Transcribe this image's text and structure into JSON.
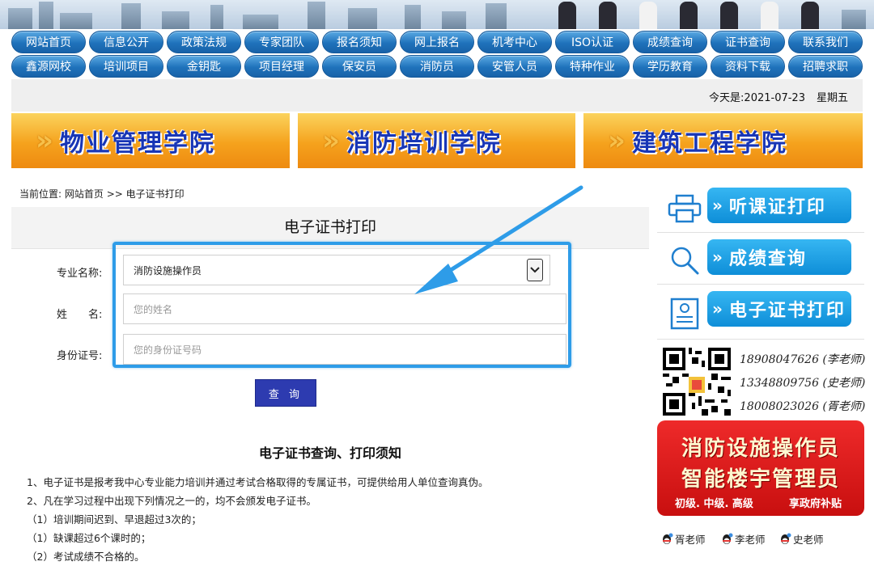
{
  "nav": {
    "row1": [
      "网站首页",
      "信息公开",
      "政策法规",
      "专家团队",
      "报名须知",
      "网上报名",
      "机考中心",
      "ISO认证",
      "成绩查询",
      "证书查询",
      "联系我们"
    ],
    "row2": [
      "鑫源网校",
      "培训项目",
      "金钥匙",
      "项目经理",
      "保安员",
      "消防员",
      "安管人员",
      "特种作业",
      "学历教育",
      "资料下载",
      "招聘求职"
    ]
  },
  "datebar": {
    "date": "今天是:2021-07-23",
    "weekday": "星期五"
  },
  "colleges": [
    "物业管理学院",
    "消防培训学院",
    "建筑工程学院"
  ],
  "breadcrumb": {
    "prefix": "当前位置:",
    "home": "网站首页",
    "sep": ">>",
    "current": "电子证书打印"
  },
  "panel": {
    "title": "电子证书打印"
  },
  "form": {
    "major_label": "专业名称:",
    "major_value": "消防设施操作员",
    "name_label": "姓　　名:",
    "name_placeholder": "您的姓名",
    "id_label": "身份证号:",
    "id_placeholder": "您的身份证号码",
    "submit": "查 询"
  },
  "notice": {
    "title": "电子证书查询、打印须知",
    "lines": [
      "1、电子证书是报考我中心专业能力培训并通过考试合格取得的专属证书，可提供给用人单位查询真伪。",
      "2、凡在学习过程中出现下列情况之一的，均不会颁发电子证书。",
      "（1）培训期间迟到、早退超过3次的；",
      "（1）缺课超过6个课时的；",
      "（2）考试成绩不合格的。"
    ]
  },
  "sidebar": {
    "items": [
      "听课证打印",
      "成绩查询",
      "电子证书打印"
    ],
    "phones": [
      "18908047626 (李老师)",
      "13348809756 (史老师)",
      "18008023026 (胥老师)"
    ],
    "promo": {
      "line1": "消防设施操作员",
      "line2": "智能楼宇管理员",
      "levels": "初级. 中级. 高级",
      "subsidy": "享政府补贴"
    },
    "qq": [
      "胥老师",
      "李老师",
      "史老师"
    ]
  },
  "colors": {
    "nav_blue": "#1f72bb",
    "highlight": "#2e9ce8",
    "button": "#2d3bb0",
    "college_title": "#1836b6",
    "promo_red": "#d71a1a"
  }
}
